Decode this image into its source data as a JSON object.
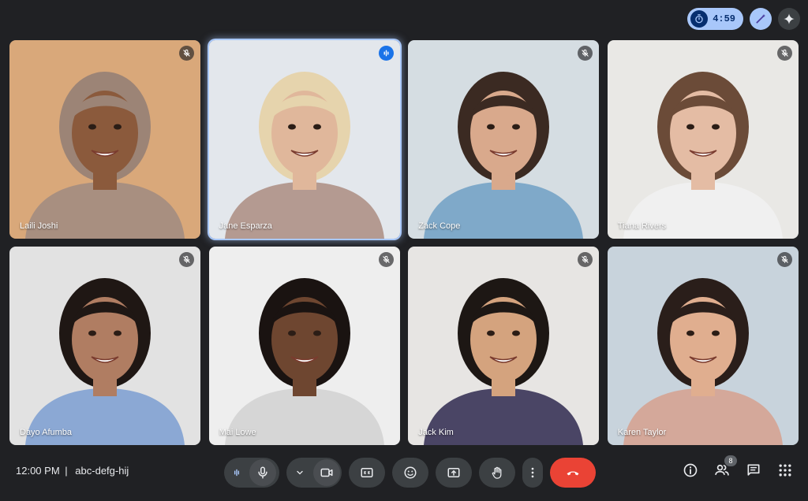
{
  "top_bar": {
    "timer": "4:59",
    "timer_icon": "timer-icon",
    "pen_icon": "magic-pen-icon",
    "sparkle_icon": "sparkle-icon"
  },
  "participants": [
    {
      "name": "Laili Joshi",
      "muted": true,
      "bg": "#d9a87a",
      "skin": "#8b5a3c",
      "hair": "#9c8476",
      "shirt": "#a88f80"
    },
    {
      "name": "Jane Esparza",
      "muted": false,
      "speaking": true,
      "bg": "#e3e7ec",
      "skin": "#e0b79b",
      "hair": "#e6d4ad",
      "shirt": "#b49a91"
    },
    {
      "name": "Zack Cope",
      "muted": true,
      "bg": "#d5dde2",
      "skin": "#d9a98c",
      "hair": "#3b2a22",
      "shirt": "#7fa9c9"
    },
    {
      "name": "Tiana Rivers",
      "muted": true,
      "bg": "#e9e8e5",
      "skin": "#e4bca4",
      "hair": "#6b4b38",
      "shirt": "#f0f0f0"
    },
    {
      "name": "Dayo Afumba",
      "muted": true,
      "bg": "#e2e2e2",
      "skin": "#b07d62",
      "hair": "#1f1714",
      "shirt": "#8ba8d4"
    },
    {
      "name": "Mai Lowe",
      "muted": true,
      "bg": "#eeeeee",
      "skin": "#6e4630",
      "hair": "#1a1311",
      "shirt": "#d6d6d6"
    },
    {
      "name": "Jack Kim",
      "muted": true,
      "bg": "#e7e5e3",
      "skin": "#d4a37e",
      "hair": "#1d1714",
      "shirt": "#4a4565"
    },
    {
      "name": "Karen Taylor",
      "muted": true,
      "bg": "#c8d3dc",
      "skin": "#e0ae8f",
      "hair": "#2a1e1a",
      "shirt": "#d4a89a"
    }
  ],
  "bottom_bar": {
    "time": "12:00 PM",
    "separator": "|",
    "meeting_code": "abc-defg-hij",
    "controls": [
      {
        "name": "mic-button",
        "icon": "mic-icon"
      },
      {
        "name": "camera-button",
        "icon": "videocam-icon"
      },
      {
        "name": "captions-button",
        "icon": "captions-icon"
      },
      {
        "name": "reactions-button",
        "icon": "emoji-icon"
      },
      {
        "name": "present-button",
        "icon": "present-screen-icon"
      },
      {
        "name": "raise-hand-button",
        "icon": "hand-icon"
      },
      {
        "name": "more-options-button",
        "icon": "more-vert-icon"
      },
      {
        "name": "leave-call-button",
        "icon": "call-end-icon"
      }
    ],
    "participant_count": "8",
    "colors": {
      "end_call": "#ea4335",
      "accent": "#a8c7fa"
    }
  }
}
